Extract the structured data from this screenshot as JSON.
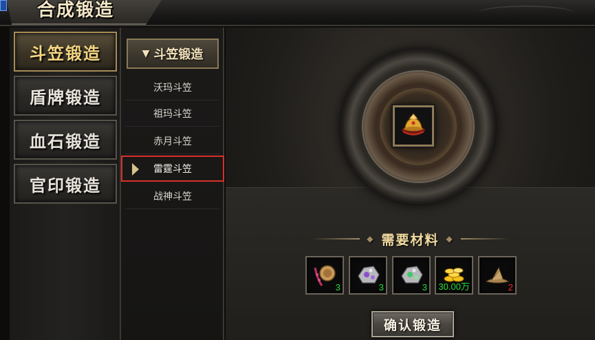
{
  "window": {
    "title": "合成锻造"
  },
  "tabs": [
    {
      "label": "斗笠锻造",
      "active": true
    },
    {
      "label": "盾牌锻造",
      "active": false
    },
    {
      "label": "血石锻造",
      "active": false
    },
    {
      "label": "官印锻造",
      "active": false
    }
  ],
  "sublist": {
    "header": "斗笠锻造",
    "items": [
      {
        "label": "沃玛斗笠"
      },
      {
        "label": "祖玛斗笠"
      },
      {
        "label": "赤月斗笠"
      },
      {
        "label": "雷霆斗笠",
        "selected": true
      },
      {
        "label": "战神斗笠"
      }
    ]
  },
  "result": {
    "icon": "golden-helmet-icon"
  },
  "materials": {
    "title": "需要材料",
    "items": [
      {
        "icon": "gem-bead-icon",
        "count": "3",
        "count_color": "#24e03a"
      },
      {
        "icon": "silver-ore-purple-icon",
        "count": "3",
        "count_color": "#24e03a"
      },
      {
        "icon": "silver-ore-green-icon",
        "count": "3",
        "count_color": "#24e03a"
      },
      {
        "icon": "gold-coins-icon",
        "count": "30.00万",
        "count_color": "#24e03a"
      },
      {
        "icon": "straw-hat-icon",
        "count": "2",
        "count_color": "#f0302a"
      }
    ]
  },
  "actions": {
    "confirm_label": "确认锻造"
  },
  "colors": {
    "accent": "#f5d682",
    "selection_border": "#d9302a",
    "enough": "#24e03a",
    "insufficient": "#f0302a"
  }
}
